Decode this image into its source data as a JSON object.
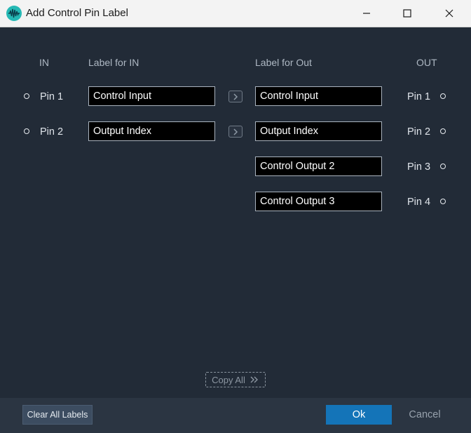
{
  "window": {
    "title": "Add Control Pin Label",
    "controls": {
      "minimize": "minimize-icon",
      "maximize": "maximize-icon",
      "close": "close-icon"
    }
  },
  "headers": {
    "in": "IN",
    "label_in": "Label for IN",
    "label_out": "Label for Out",
    "out": "OUT"
  },
  "in_pins": [
    {
      "pin": "Pin 1",
      "label": "Control Input"
    },
    {
      "pin": "Pin 2",
      "label": "Output Index"
    }
  ],
  "out_pins": [
    {
      "pin": "Pin 1",
      "label": "Control Input"
    },
    {
      "pin": "Pin 2",
      "label": "Output Index"
    },
    {
      "pin": "Pin 3",
      "label": "Control Output 2"
    },
    {
      "pin": "Pin 4",
      "label": "Control Output 3"
    }
  ],
  "copy_all_label": "Copy All",
  "footer": {
    "clear_label": "Clear All Labels",
    "ok_label": "Ok",
    "cancel_label": "Cancel"
  },
  "colors": {
    "background": "#222b37",
    "footer": "#2b3542",
    "ok_button": "#1474b8",
    "field_bg": "#000000"
  }
}
